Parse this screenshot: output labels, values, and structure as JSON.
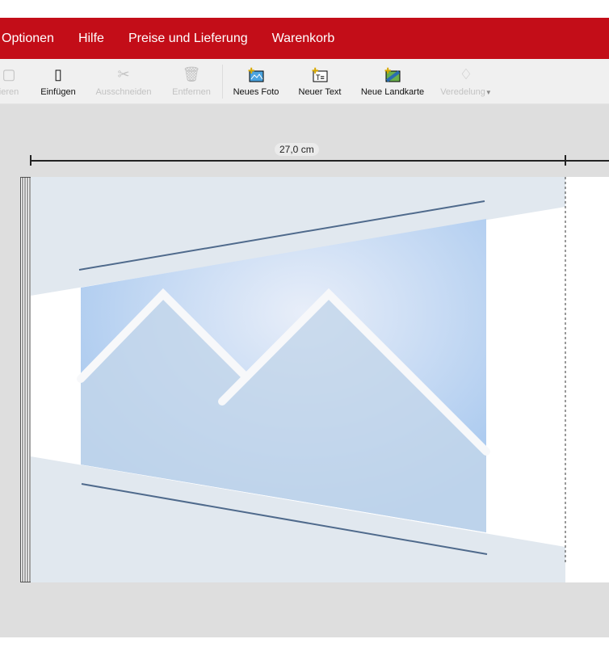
{
  "menu": {
    "items": [
      "Optionen",
      "Hilfe",
      "Preise und Lieferung",
      "Warenkorb"
    ]
  },
  "toolbar": {
    "copy": "ieren",
    "paste": "Einfügen",
    "cut": "Ausschneiden",
    "remove": "Entfernen",
    "new_photo": "Neues Foto",
    "new_text": "Neuer Text",
    "new_map": "Neue Landkarte",
    "refine": "Veredelung"
  },
  "ruler": {
    "width_label": "27,0 cm"
  },
  "colors": {
    "brand": "#c30d18"
  }
}
